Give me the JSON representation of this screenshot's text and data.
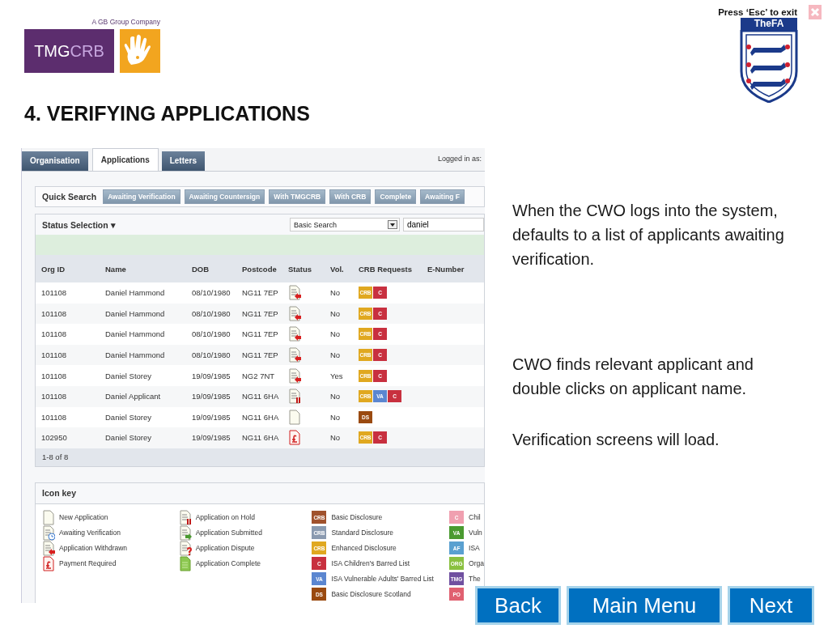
{
  "header": {
    "tagline": "A GB Group Company",
    "logo": {
      "part_1": "TMG",
      "part_2": "CRB"
    },
    "exit_hint": "Press ‘Esc’ to exit",
    "crest_label": "TheFA"
  },
  "title": "4. VERIFYING APPLICATIONS",
  "app": {
    "tabs": [
      {
        "label": "Organisation",
        "selected": false
      },
      {
        "label": "Applications",
        "selected": true
      },
      {
        "label": "Letters",
        "selected": false
      }
    ],
    "logged_in": "Logged in as:",
    "quick_search": {
      "label": "Quick Search",
      "buttons": [
        "Awaiting Verification",
        "Awaiting Countersign",
        "With TMGCRB",
        "With CRB",
        "Complete",
        "Awaiting F"
      ]
    },
    "status_selection": "Status Selection ▾",
    "search_type": "Basic Search",
    "search_value": "daniel",
    "table": {
      "columns": [
        "Org ID",
        "Name",
        "DOB",
        "Postcode",
        "Status",
        "Vol.",
        "CRB Requests",
        "E-Number"
      ],
      "rows": [
        {
          "org_id": "101108",
          "name": "Daniel Hammond",
          "dob": "08/10/1980",
          "postcode": "NG11 7EP",
          "kind": "withdrawn",
          "vol": "No",
          "requests": [
            {
              "label": "CRB",
              "color": "#e0a820"
            },
            {
              "label": "C",
              "color": "#c8303f"
            }
          ]
        },
        {
          "org_id": "101108",
          "name": "Daniel Hammond",
          "dob": "08/10/1980",
          "postcode": "NG11 7EP",
          "kind": "withdrawn",
          "vol": "No",
          "requests": [
            {
              "label": "CRB",
              "color": "#e0a820"
            },
            {
              "label": "C",
              "color": "#c8303f"
            }
          ]
        },
        {
          "org_id": "101108",
          "name": "Daniel Hammond",
          "dob": "08/10/1980",
          "postcode": "NG11 7EP",
          "kind": "withdrawn",
          "vol": "No",
          "requests": [
            {
              "label": "CRB",
              "color": "#e0a820"
            },
            {
              "label": "C",
              "color": "#c8303f"
            }
          ]
        },
        {
          "org_id": "101108",
          "name": "Daniel Hammond",
          "dob": "08/10/1980",
          "postcode": "NG11 7EP",
          "kind": "withdrawn",
          "vol": "No",
          "requests": [
            {
              "label": "CRB",
              "color": "#e0a820"
            },
            {
              "label": "C",
              "color": "#c8303f"
            }
          ]
        },
        {
          "org_id": "101108",
          "name": "Daniel Storey",
          "dob": "19/09/1985",
          "postcode": "NG2 7NT",
          "kind": "withdrawn",
          "vol": "Yes",
          "requests": [
            {
              "label": "CRB",
              "color": "#e0a820"
            },
            {
              "label": "C",
              "color": "#c8303f"
            }
          ]
        },
        {
          "org_id": "101108",
          "name": "Daniel Applicant",
          "dob": "19/09/1985",
          "postcode": "NG11 6HA",
          "kind": "hold",
          "vol": "No",
          "requests": [
            {
              "label": "CRB",
              "color": "#e0a820"
            },
            {
              "label": "VA",
              "color": "#5b86d0"
            },
            {
              "label": "C",
              "color": "#c8303f"
            }
          ]
        },
        {
          "org_id": "101108",
          "name": "Daniel Storey",
          "dob": "19/09/1985",
          "postcode": "NG11 6HA",
          "kind": "new",
          "vol": "No",
          "requests": [
            {
              "label": "DS",
              "color": "#9a4a10"
            }
          ]
        },
        {
          "org_id": "102950",
          "name": "Daniel Storey",
          "dob": "19/09/1985",
          "postcode": "NG11 6HA",
          "kind": "payment",
          "vol": "No",
          "requests": [
            {
              "label": "CRB",
              "color": "#e0a820"
            },
            {
              "label": "C",
              "color": "#c8303f"
            }
          ]
        }
      ],
      "footer": "1-8 of 8"
    },
    "icon_key": {
      "title": "Icon key",
      "columns": [
        [
          {
            "kind": "new",
            "label": "New Application"
          },
          {
            "kind": "awaiting",
            "label": "Awaiting Verification"
          },
          {
            "kind": "withdrawn",
            "label": "Application Withdrawn"
          },
          {
            "kind": "payment",
            "label": "Payment Required"
          }
        ],
        [
          {
            "kind": "hold",
            "label": "Application on Hold"
          },
          {
            "kind": "submitted",
            "label": "Application Submitted"
          },
          {
            "kind": "dispute",
            "label": "Application Dispute"
          },
          {
            "kind": "complete",
            "label": "Application Complete"
          }
        ],
        [
          {
            "kind": "badge",
            "badge": "CRB",
            "color": "#a0522d",
            "label": "Basic Disclosure"
          },
          {
            "kind": "badge",
            "badge": "CRB",
            "color": "#8a9ab0",
            "label": "Standard Disclosure"
          },
          {
            "kind": "badge",
            "badge": "CRB",
            "color": "#e0a820",
            "label": "Enhanced Disclosure"
          },
          {
            "kind": "badge",
            "badge": "C",
            "color": "#c8303f",
            "label": "ISA Children's Barred List"
          },
          {
            "kind": "badge",
            "badge": "VA",
            "color": "#5b86d0",
            "label": "ISA Vulnerable Adults' Barred List"
          },
          {
            "kind": "badge",
            "badge": "DS",
            "color": "#9a4a10",
            "label": "Basic Disclosure Scotland"
          }
        ],
        [
          {
            "kind": "badge",
            "badge": "C",
            "color": "#f0a0b0",
            "label": "Chil"
          },
          {
            "kind": "badge",
            "badge": "VA",
            "color": "#4a9a30",
            "label": "Vuln"
          },
          {
            "kind": "badge",
            "badge": "AF",
            "color": "#5aa0d0",
            "label": "ISA"
          },
          {
            "kind": "badge",
            "badge": "ORG",
            "color": "#8ac040",
            "label": "Orga"
          },
          {
            "kind": "badge",
            "badge": "TMG",
            "color": "#7050a0",
            "label": "The"
          },
          {
            "kind": "badge",
            "badge": "PO",
            "color": "#e06070"
          }
        ]
      ]
    }
  },
  "notes": [
    "When the CWO logs into the system, defaults to a list of applicants awaiting verification.",
    "CWO finds relevant applicant and double clicks on applicant name.",
    "Verification screens will load."
  ],
  "nav_buttons": [
    "Back",
    "Main Menu",
    "Next"
  ]
}
